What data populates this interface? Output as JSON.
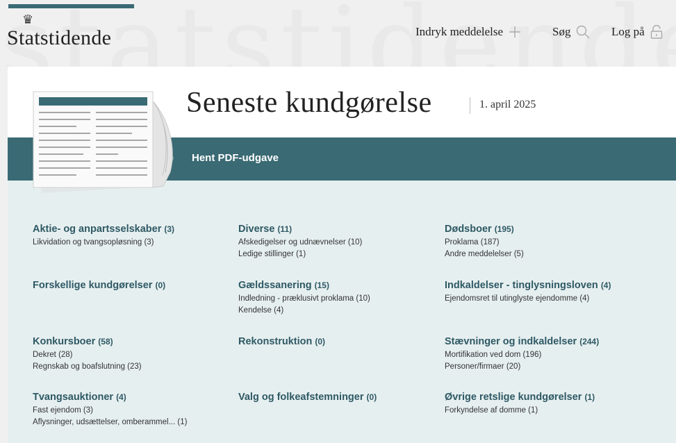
{
  "header": {
    "watermark": "statstidende",
    "logo": "Statstidende",
    "nav": {
      "submit": "Indryk meddelelse",
      "search": "Søg",
      "login": "Log på"
    }
  },
  "hero": {
    "title": "Seneste kundgørelse",
    "date": "1. april 2025",
    "pdf_link": "Hent PDF-udgave"
  },
  "categories": [
    {
      "title": "Aktie- og anpartsselskaber",
      "count": "(3)",
      "subs": [
        "Likvidation og tvangsopløsning (3)"
      ]
    },
    {
      "title": "Diverse",
      "count": "(11)",
      "subs": [
        "Afskedigelser og udnævnelser (10)",
        "Ledige stillinger (1)"
      ]
    },
    {
      "title": "Dødsboer",
      "count": "(195)",
      "subs": [
        "Proklama (187)",
        "Andre meddelelser (5)"
      ]
    },
    {
      "title": "Forskellige kundgørelser",
      "count": "(0)",
      "subs": []
    },
    {
      "title": "Gældssanering",
      "count": "(15)",
      "subs": [
        "Indledning - præklusivt proklama (10)",
        "Kendelse (4)"
      ]
    },
    {
      "title": "Indkaldelser - tinglysningsloven",
      "count": "(4)",
      "subs": [
        "Ejendomsret til utinglyste ejendomme (4)"
      ]
    },
    {
      "title": "Konkursboer",
      "count": "(58)",
      "subs": [
        "Dekret (28)",
        "Regnskab og boafslutning (23)"
      ]
    },
    {
      "title": "Rekonstruktion",
      "count": "(0)",
      "subs": []
    },
    {
      "title": "Stævninger og indkaldelser",
      "count": "(244)",
      "subs": [
        "Mortifikation ved dom (196)",
        "Personer/firmaer (20)"
      ]
    },
    {
      "title": "Tvangsauktioner",
      "count": "(4)",
      "subs": [
        "Fast ejendom (3)",
        "Aflysninger, udsættelser, omberammel... (1)"
      ]
    },
    {
      "title": "Valg og folkeafstemninger",
      "count": "(0)",
      "subs": []
    },
    {
      "title": "Øvrige retslige kundgørelser",
      "count": "(1)",
      "subs": [
        "Forkyndelse af domme (1)"
      ]
    }
  ],
  "colors": {
    "accent": "#3a6a74",
    "heading": "#2e5964",
    "lower_bg": "#e6eff0"
  }
}
